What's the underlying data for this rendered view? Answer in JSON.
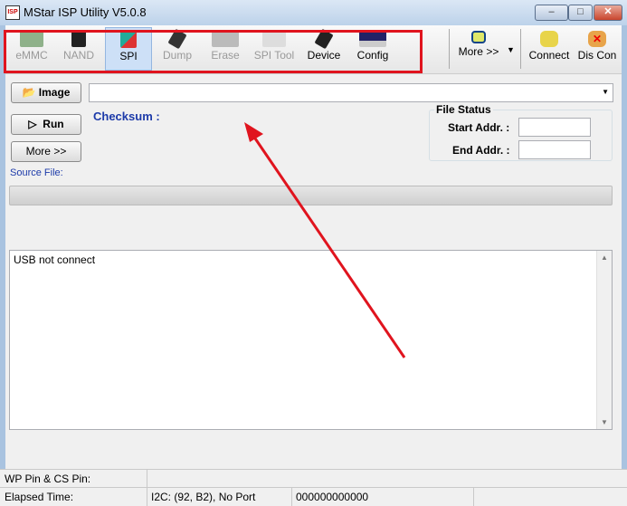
{
  "window": {
    "title": "MStar ISP Utility V5.0.8",
    "icon_text": "ISP"
  },
  "toolbar": {
    "items": [
      {
        "label": "eMMC",
        "enabled": false
      },
      {
        "label": "NAND",
        "enabled": false
      },
      {
        "label": "SPI",
        "enabled": true,
        "selected": true
      },
      {
        "label": "Dump",
        "enabled": false
      },
      {
        "label": "Erase",
        "enabled": false
      },
      {
        "label": "SPI Tool",
        "enabled": false
      },
      {
        "label": "Device",
        "enabled": true
      },
      {
        "label": "Config",
        "enabled": true
      }
    ],
    "more": "More >>",
    "connect": "Connect",
    "disconnect": "Dis Con"
  },
  "main": {
    "image_button": "Image",
    "run_button": "Run",
    "more_button": "More >>",
    "checksum_label": "Checksum :",
    "source_file_label": "Source File:",
    "image_path": "",
    "progress": 0
  },
  "file_status": {
    "title": "File Status",
    "start_label": "Start Addr. :",
    "end_label": "End Addr. :",
    "start_value": "",
    "end_value": ""
  },
  "log": {
    "text": "USB not connect"
  },
  "statusbar": {
    "wp_label": "WP Pin & CS Pin:",
    "elapsed_label": "Elapsed Time:",
    "i2c": "I2C: (92, B2), No Port",
    "counter": "000000000000"
  }
}
